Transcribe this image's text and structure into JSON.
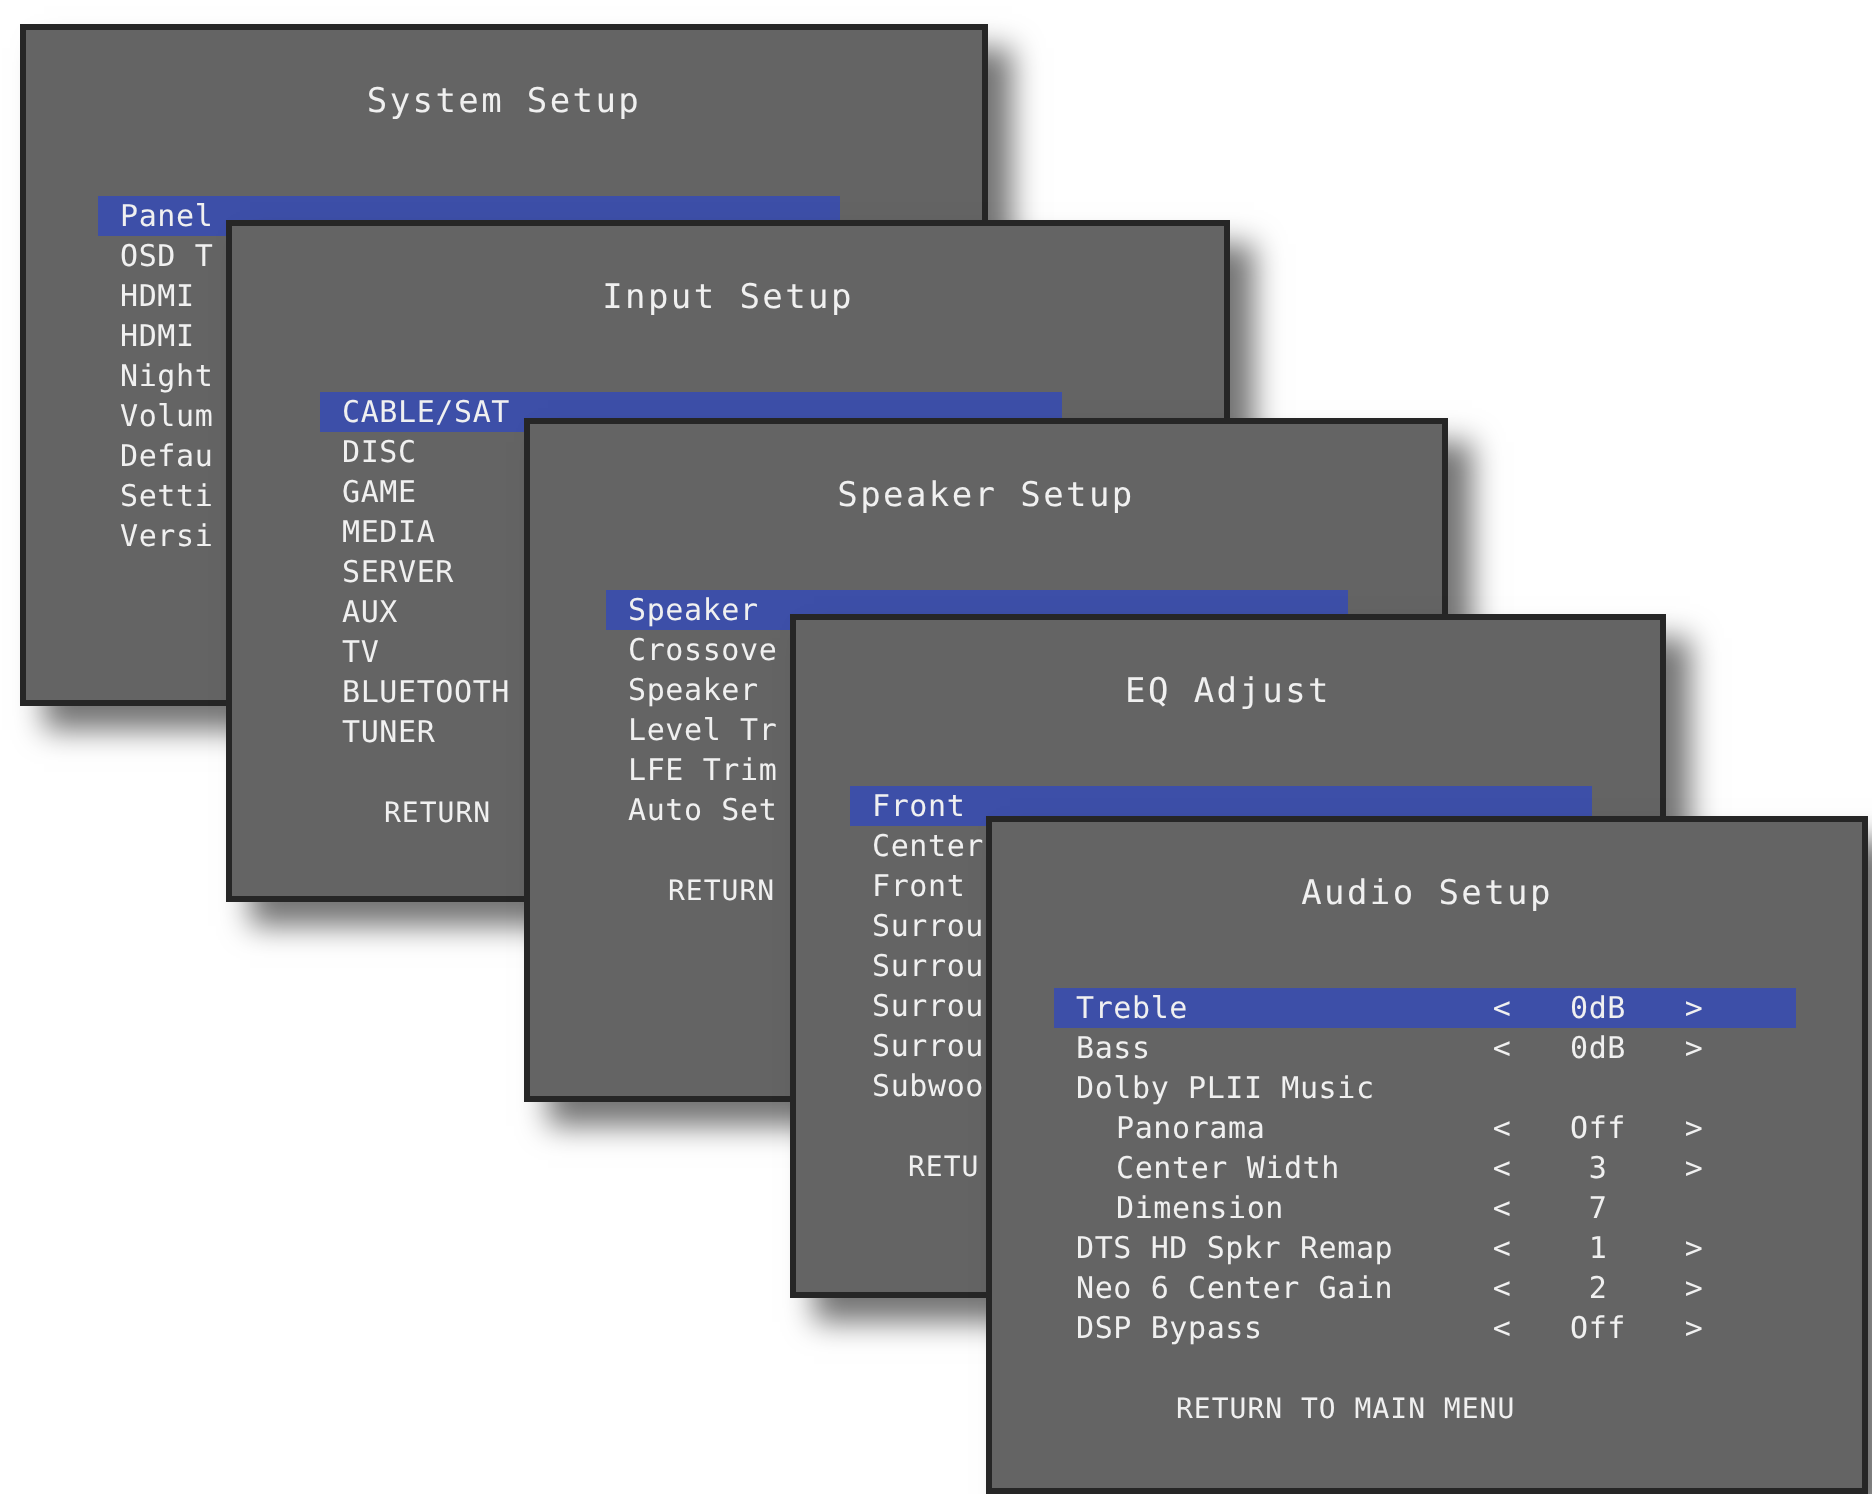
{
  "menus": [
    {
      "title": "System Setup",
      "items": [
        {
          "label": "Panel",
          "selected": true
        },
        {
          "label": "OSD T",
          "selected": false
        },
        {
          "label": "HDMI",
          "selected": false
        },
        {
          "label": "HDMI",
          "selected": false
        },
        {
          "label": "Night",
          "selected": false
        },
        {
          "label": "Volum",
          "selected": false
        },
        {
          "label": "Defau",
          "selected": false
        },
        {
          "label": "Setti",
          "selected": false
        },
        {
          "label": "Versi",
          "selected": false
        }
      ]
    },
    {
      "title": "Input Setup",
      "items": [
        {
          "label": "CABLE/SAT",
          "selected": true
        },
        {
          "label": "DISC",
          "selected": false
        },
        {
          "label": "GAME",
          "selected": false
        },
        {
          "label": "MEDIA",
          "selected": false
        },
        {
          "label": "SERVER",
          "selected": false
        },
        {
          "label": "AUX",
          "selected": false
        },
        {
          "label": "TV",
          "selected": false
        },
        {
          "label": "BLUETOOTH",
          "selected": false
        },
        {
          "label": "TUNER",
          "selected": false
        }
      ],
      "footer": "RETURN"
    },
    {
      "title": "Speaker Setup",
      "items": [
        {
          "label": "Speaker",
          "selected": true
        },
        {
          "label": "Crossove",
          "selected": false
        },
        {
          "label": "Speaker",
          "selected": false
        },
        {
          "label": "Level Tr",
          "selected": false
        },
        {
          "label": "LFE Trim",
          "selected": false
        },
        {
          "label": "Auto Set",
          "selected": false
        }
      ],
      "footer": "RETURN"
    },
    {
      "title": "EQ Adjust",
      "items": [
        {
          "label": "Front",
          "selected": true
        },
        {
          "label": "Center",
          "selected": false
        },
        {
          "label": "Front",
          "selected": false
        },
        {
          "label": "Surrou",
          "selected": false
        },
        {
          "label": "Surrou",
          "selected": false
        },
        {
          "label": "Surrou",
          "selected": false
        },
        {
          "label": "Surrou",
          "selected": false
        },
        {
          "label": "Subwoo",
          "selected": false
        }
      ],
      "footer": "RETU"
    },
    {
      "title": "Audio Setup",
      "items": [
        {
          "label": "Treble",
          "selected": true,
          "left_arrow": "<",
          "value": "0dB",
          "right_arrow": ">"
        },
        {
          "label": "Bass",
          "selected": false,
          "left_arrow": "<",
          "value": "0dB",
          "right_arrow": ">"
        },
        {
          "label": "Dolby PLII Music",
          "selected": false,
          "children": [
            {
              "label": "Panorama",
              "selected": false,
              "left_arrow": "<",
              "value": "Off",
              "right_arrow": ">"
            },
            {
              "label": "Center Width",
              "selected": false,
              "left_arrow": "<",
              "value": "3",
              "right_arrow": ">"
            },
            {
              "label": "Dimension",
              "selected": false,
              "left_arrow": "<",
              "value": "7"
            }
          ]
        },
        {
          "label": "DTS HD Spkr Remap",
          "selected": false,
          "left_arrow": "<",
          "value": "1",
          "right_arrow": ">"
        },
        {
          "label": "Neo 6 Center Gain",
          "selected": false,
          "left_arrow": "<",
          "value": "2",
          "right_arrow": ">"
        },
        {
          "label": "DSP Bypass",
          "selected": false,
          "left_arrow": "<",
          "value": "Off",
          "right_arrow": ">"
        }
      ],
      "footer": "RETURN TO MAIN MENU"
    }
  ]
}
